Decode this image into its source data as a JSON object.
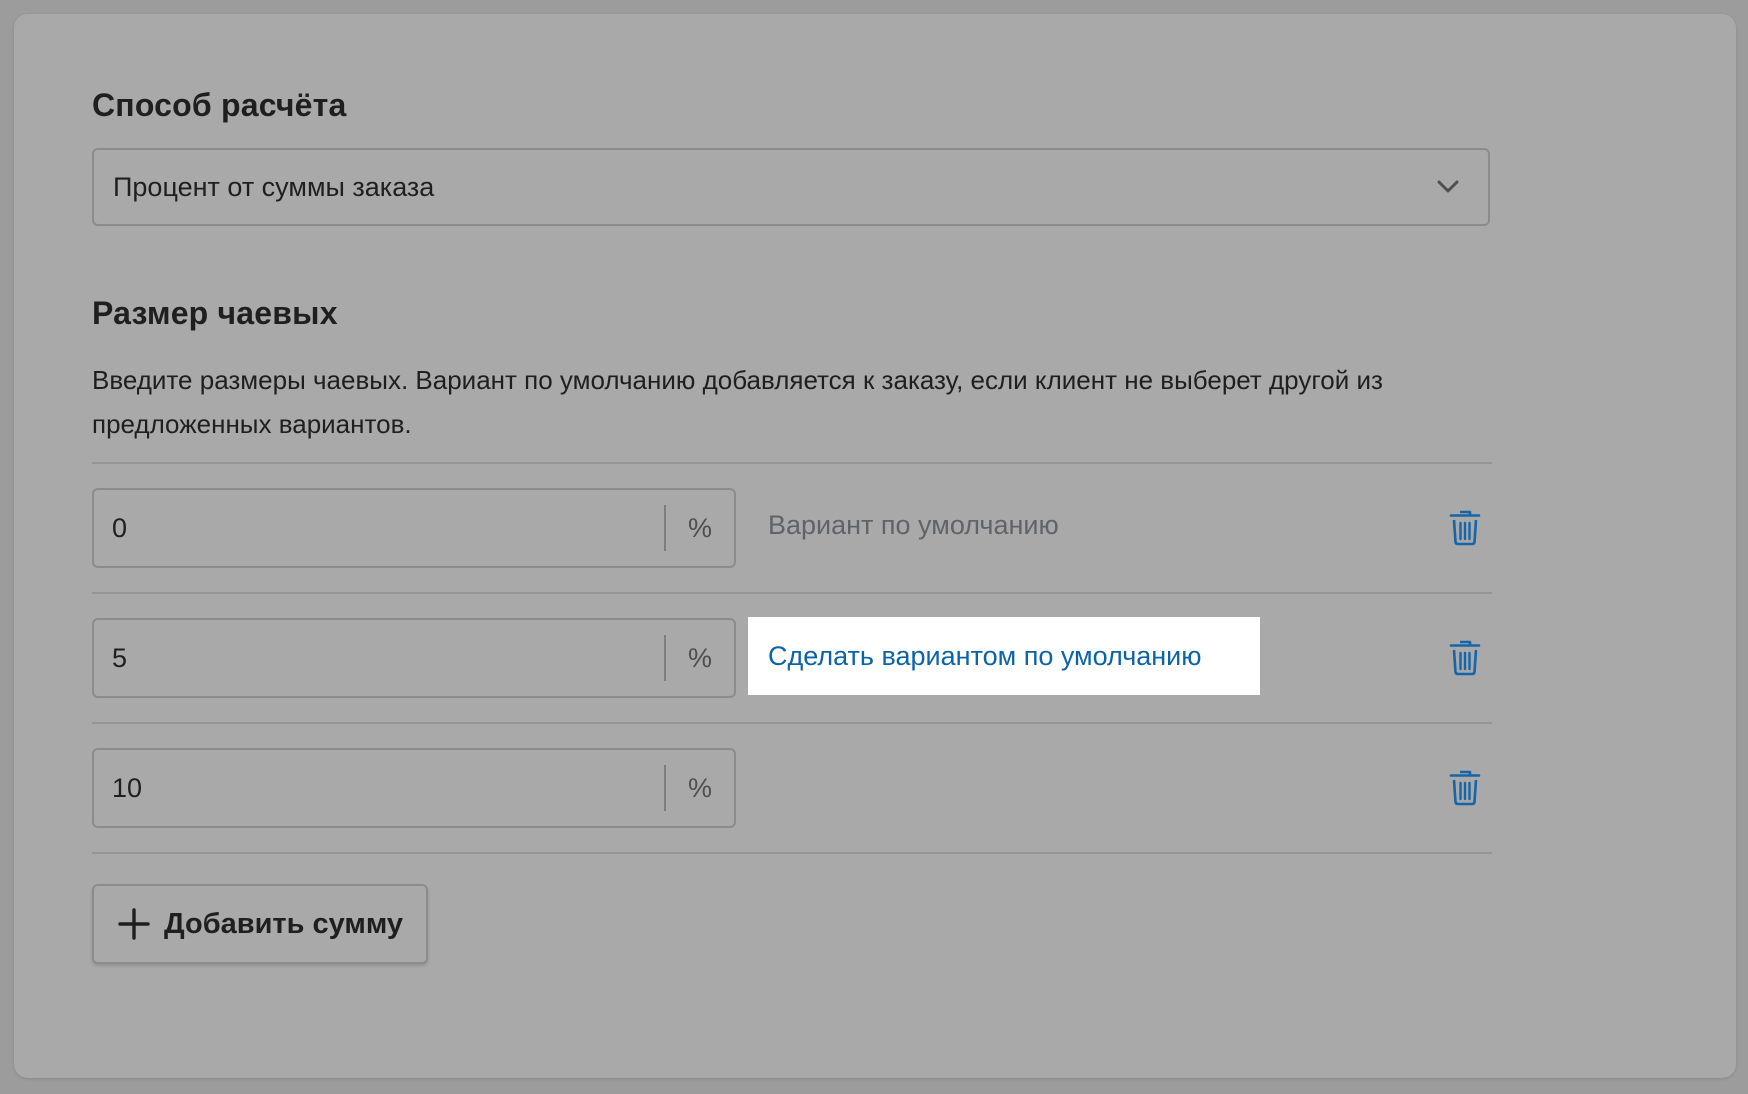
{
  "calculation": {
    "title": "Способ расчёта",
    "selected": "Процент от суммы заказа"
  },
  "tip_size": {
    "title": "Размер чаевых",
    "description": "Введите размеры чаевых. Вариант по умолчанию добавляется к заказу, если клиент не выберет другой из предложенных вариантов."
  },
  "tips": [
    {
      "value": "0",
      "unit": "%",
      "label": "Вариант по умолчанию"
    },
    {
      "value": "5",
      "unit": "%",
      "action": "Сделать вариантом по умолчанию"
    },
    {
      "value": "10",
      "unit": "%"
    }
  ],
  "add_button": {
    "label": "Добавить сумму"
  },
  "icons": {
    "dropdown": "chevron-down-icon",
    "delete": "trash-icon",
    "add": "plus-icon"
  },
  "colors": {
    "link": "#0c63a8",
    "trash": "#1565a8",
    "overlay_background": "#a9a9a9",
    "highlight": "#ffffff"
  }
}
